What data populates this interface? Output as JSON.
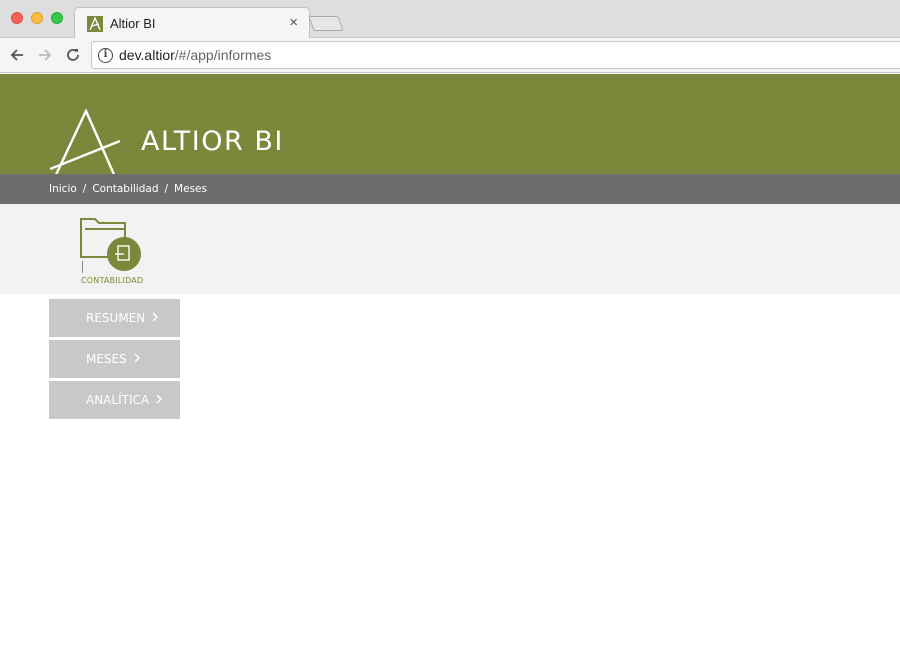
{
  "browser": {
    "tab_title": "Altior BI",
    "tab_close": "×",
    "url_host": "dev.altior",
    "url_path": "/#/app/informes"
  },
  "header": {
    "brand": "ALTIOR BI"
  },
  "breadcrumb": {
    "items": [
      "Inicio",
      "Contabilidad",
      "Meses"
    ],
    "separator": "/"
  },
  "module": {
    "label": "CONTABILIDAD"
  },
  "menu": {
    "items": [
      {
        "label": "RESUMEN"
      },
      {
        "label": "MESES"
      },
      {
        "label": "ANALÍTICA"
      }
    ],
    "chevron": "›"
  },
  "colors": {
    "brand": "#7a883b",
    "breadcrumb_bg": "#6d6d6d",
    "menu_bg": "#c8c8c8"
  },
  "icons": {
    "back": "arrow-left-icon",
    "forward": "arrow-right-icon",
    "reload": "reload-icon",
    "info": "info-icon",
    "module": "folder-document-icon"
  }
}
